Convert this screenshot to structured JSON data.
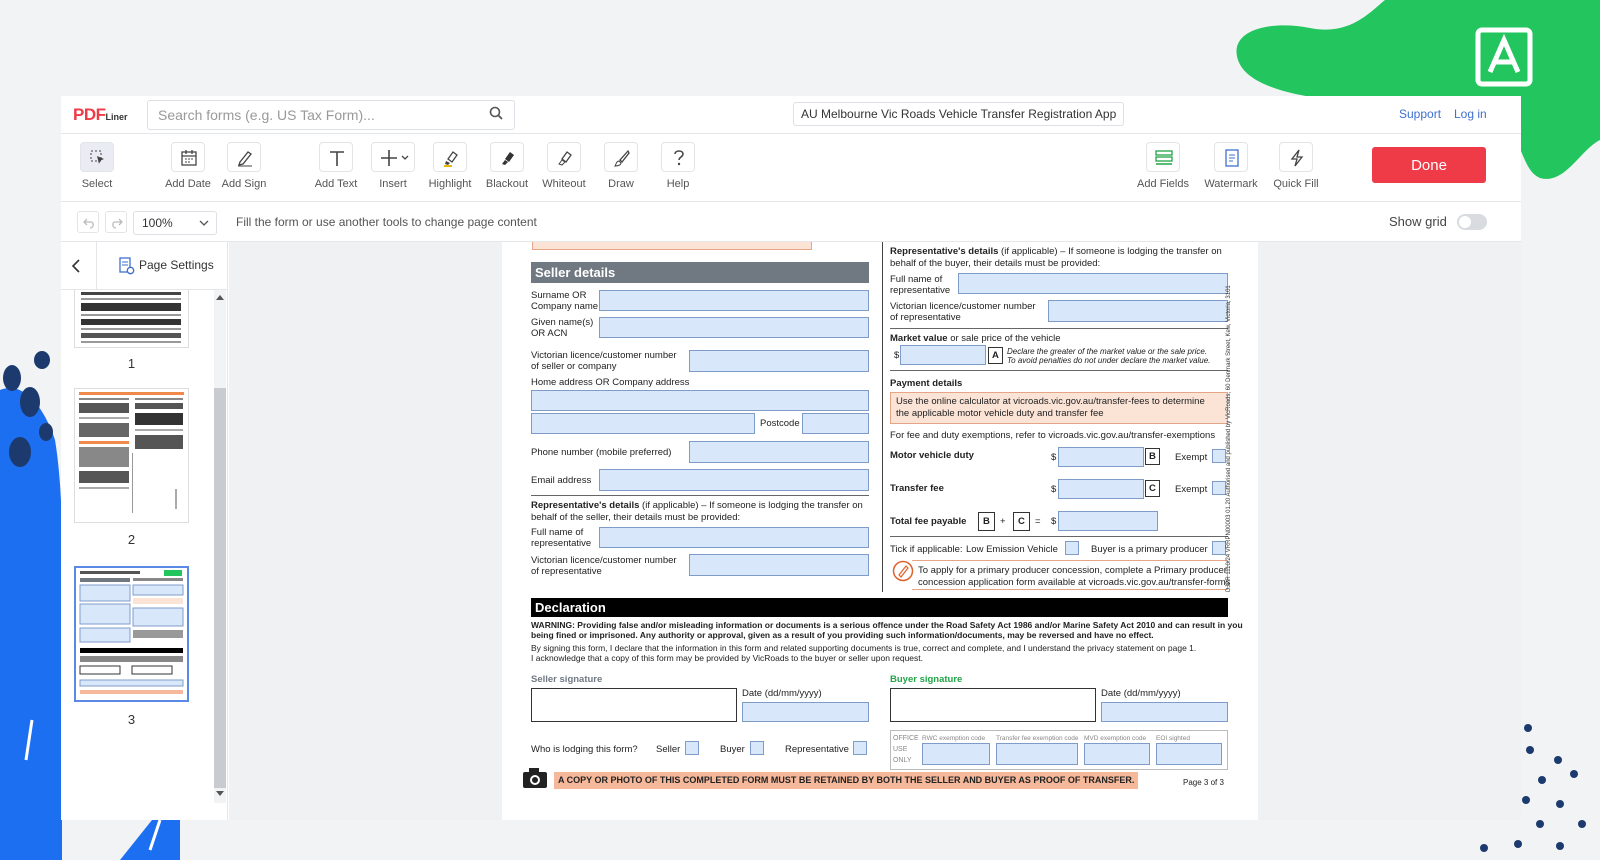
{
  "app": {
    "logo_main": "PDF",
    "logo_sub": "Liner",
    "search_placeholder": "Search forms (e.g. US Tax Form)...",
    "doc_title": "AU Melbourne Vic Roads Vehicle Transfer Registration App",
    "support": "Support",
    "login": "Log in"
  },
  "toolbar": {
    "select": "Select",
    "add_date": "Add Date",
    "add_sign": "Add Sign",
    "add_text": "Add Text",
    "insert": "Insert",
    "highlight": "Highlight",
    "blackout": "Blackout",
    "whiteout": "Whiteout",
    "draw": "Draw",
    "help": "Help",
    "add_fields": "Add Fields",
    "watermark": "Watermark",
    "quick_fill": "Quick Fill",
    "done": "Done"
  },
  "subbar": {
    "zoom": "100%",
    "hint": "Fill the form or use another tools to change page content",
    "show_grid": "Show grid"
  },
  "sidebar": {
    "page_settings": "Page Settings",
    "pages": [
      "1",
      "2",
      "3"
    ]
  },
  "form": {
    "seller_title": "Seller details",
    "surname": "Surname OR\nCompany name",
    "given": "Given name(s)\nOR ACN",
    "licence": "Victorian licence/customer number",
    "licence2": "of seller or company",
    "address": "Home address OR Company address",
    "postcode": "Postcode",
    "phone": "Phone number (mobile preferred)",
    "email": "Email address",
    "rep_bold": "Representative's details",
    "rep_rest": "(if applicable) – If someone is lodging the transfer on",
    "rep_line2_seller": "behalf of the seller, their details must be provided:",
    "rep_line2_buyer": "behalf of the buyer, their details must be provided:",
    "rep_name": "Full name of\nrepresentative",
    "rep_lic": "Victorian licence/customer number",
    "rep_lic2": "of representative",
    "market": "Market value",
    "market_rest": "or sale price of the vehicle",
    "dollar": "$",
    "a_label": "A",
    "b_label": "B",
    "c_label": "C",
    "market_note1": "Declare the greater of the market value or the sale price.",
    "market_note2": "To avoid penalties do not under declare the market value.",
    "payment": "Payment details",
    "pay_note1": "Use the online calculator at vicroads.vic.gov.au/transfer-fees to determine",
    "pay_note2": "the applicable motor vehicle duty and transfer fee",
    "exemptions": "For fee and duty exemptions, refer to vicroads.vic.gov.au/transfer-exemptions",
    "duty": "Motor vehicle duty",
    "fee": "Transfer fee",
    "exempt": "Exempt",
    "total": "Total fee payable",
    "plus": "+",
    "equals": "=",
    "tick": "Tick if applicable:",
    "low_em": "Low Emission Vehicle",
    "primary": "Buyer is a primary producer",
    "concession1": "To apply for a primary producer concession, complete a Primary producer",
    "concession2": "concession application form available at vicroads.vic.gov.au/transfer-forms",
    "declaration": "Declaration",
    "warn1": "WARNING: Providing false and/or misleading information or documents is a serious offence under the Road Safety Act 1986 and/or Marine Safety Act 2010 and can result in you",
    "warn2": "being fined or imprisoned. Any authority or approval, given as a result of you providing such information/documents, may be reversed and have no effect.",
    "decl1": "By signing this form, I declare that the information in this form and related supporting documents is true, correct and complete, and I understand the privacy statement on page 1.",
    "decl2": "I acknowledge that a copy of this form may be provided by VicRoads to the buyer or seller upon request.",
    "seller_sig": "Seller signature",
    "buyer_sig": "Buyer signature",
    "date": "Date (dd/mm/yyyy)",
    "who": "Who is lodging this form?",
    "seller": "Seller",
    "buyer": "Buyer",
    "representative": "Representative",
    "office": "OFFICE\nUSE\nONLY",
    "rwc": "RWC exemption code",
    "tfe": "Transfer fee exemption code",
    "mvd": "MVD exemption code",
    "eoi": "EOI sighted",
    "copy": "A COPY OR PHOTO OF THIS COMPLETED FORM MUST BE RETAINED BY BOTH THE SELLER AND BUYER AS PROOF OF TRANSFER.",
    "pagenum": "Page 3 of 3",
    "side_text": "DJPR 1110/24 VRRPN00003 01.20 Authorised and published by VicRoads, 60 Denmark Street, Kew, Victoria, 3101"
  },
  "colors": {
    "accent_red": "#ef3a47",
    "brand_green": "#22c55e",
    "deco_blue": "#1d6ff2",
    "field_blue": "#d9e7fb",
    "link": "#3f6fd1"
  }
}
